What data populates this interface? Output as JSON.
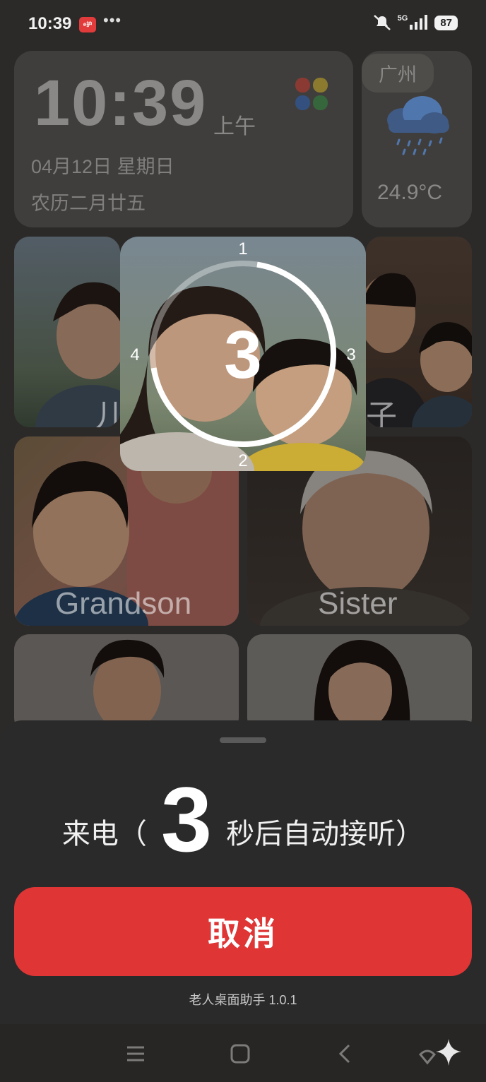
{
  "status_bar": {
    "time": "10:39",
    "app_badge": "e护",
    "more": "•••",
    "network": "5G",
    "battery": "87"
  },
  "clock_widget": {
    "time": "10:39",
    "ampm": "上午",
    "date": "04月12日  星期日",
    "lunar": "农历二月廿五"
  },
  "weather_widget": {
    "city": "广州",
    "temperature": "24.9°C",
    "icon": "rain-cloud-icon"
  },
  "contacts": [
    {
      "label": "儿"
    },
    {
      "label": "子"
    },
    {
      "label": "Grandson"
    },
    {
      "label": "Sister"
    },
    {
      "label": ""
    },
    {
      "label": ""
    }
  ],
  "countdown": {
    "current": "3",
    "ticks": [
      "1",
      "3",
      "2",
      "4"
    ],
    "progress": 0.75
  },
  "incoming": {
    "prefix": "来电（",
    "seconds": "3",
    "suffix": "秒后自动接听）",
    "cancel_label": "取消",
    "version": "老人桌面助手 1.0.1"
  },
  "navbar": {
    "items": [
      "menu-icon",
      "home-icon",
      "back-icon",
      "assistant-icon"
    ]
  },
  "colors": {
    "accent": "#df3535",
    "background": "#2b2a29",
    "sheet": "#2a2a2a"
  }
}
